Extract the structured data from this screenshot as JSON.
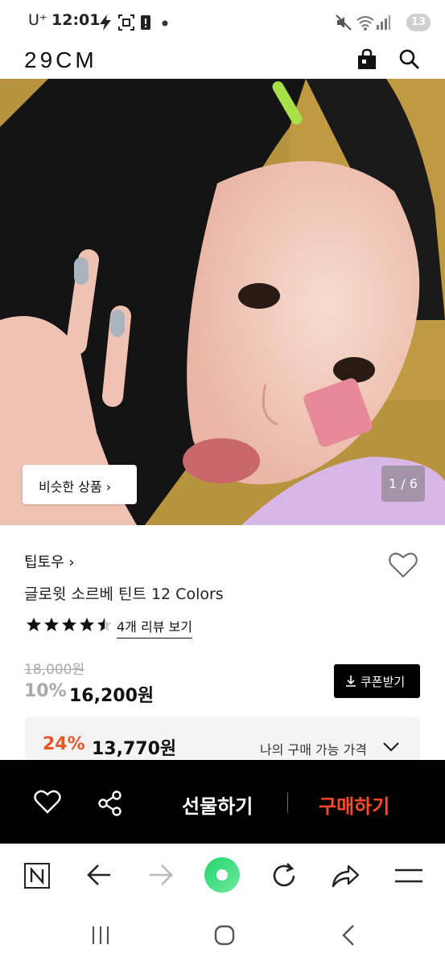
{
  "status_bar": {
    "carrier": "U⁺",
    "time": "12:01",
    "battery_badge": "13"
  },
  "header": {
    "logo": "29CM",
    "icons": [
      "shopping-bag-icon",
      "search-icon"
    ]
  },
  "hero": {
    "similar_button": "비슷한 상품 ›",
    "page_indicator": "1 / 6"
  },
  "product": {
    "brand": "팁토우 ›",
    "title": "글로윗 소르베 틴트 12 Colors",
    "rating_stars": 4.5,
    "review_link": "4개 리뷰 보기",
    "original_price": "18,000원",
    "discount_rate": "10%",
    "sale_price": "16,200원",
    "coupon_button": "쿠폰받기",
    "best_discount_rate": "24%",
    "best_price": "13,770원",
    "best_price_label": "나의 구매 가능 가격"
  },
  "action_bar": {
    "gift_label": "선물하기",
    "buy_label": "구매하기",
    "accent_color": "#ff4a2b"
  },
  "browser_bar": {
    "icons": [
      "naver-n-icon",
      "back-arrow-icon",
      "forward-arrow-icon",
      "home-green-icon",
      "refresh-icon",
      "share-icon",
      "menu-icon"
    ]
  },
  "nav_bar": {
    "icons": [
      "recents-icon",
      "home-icon",
      "back-icon"
    ]
  }
}
